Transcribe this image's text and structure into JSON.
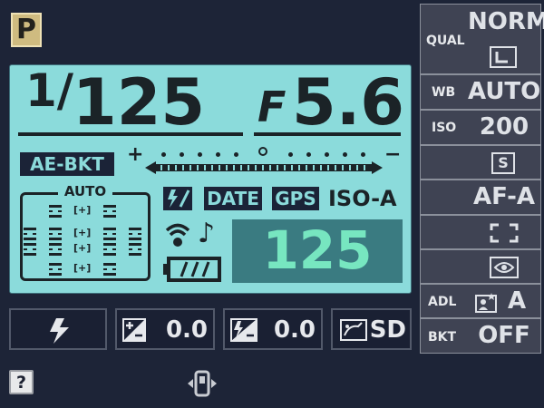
{
  "mode": "P",
  "exposure": {
    "shutter_prefix": "1/",
    "shutter_value": "125",
    "aperture_prefix": "F",
    "aperture_value": "5.6",
    "bracketing_label": "AE-BKT",
    "meter_plus": "+",
    "meter_minus": "−",
    "meter_value": 0
  },
  "focus": {
    "area_label": "AUTO"
  },
  "indicators": {
    "date": "DATE",
    "gps": "GPS",
    "iso_auto": "ISO-A",
    "iso_value": "125"
  },
  "bottom_info": {
    "flash_comp": "0.0",
    "exposure_comp": "0.0",
    "picture_control": "SD"
  },
  "settings": {
    "qual_label": "QUAL",
    "qual_value": "NORM",
    "wb_label": "WB",
    "wb_value": "AUTO",
    "iso_label": "ISO",
    "iso_value": "200",
    "release_value": "S",
    "af_value": "AF-A",
    "adl_label": "ADL",
    "adl_value": "A",
    "bkt_label": "BKT",
    "bkt_value": "OFF"
  },
  "help": {
    "label": "?"
  },
  "colors": {
    "lcd": "#8bdbdb",
    "lcd_ink": "#1b2327",
    "iso_display_bg": "#3a7b81",
    "iso_display_text": "#77e6c0",
    "background": "#1d2437",
    "panel": "#3f4353"
  },
  "icons": [
    "flash-icon",
    "exposure-comp-icon",
    "flash-comp-icon",
    "picture-control-icon",
    "wifi-icon",
    "music-icon",
    "battery-icon",
    "image-size-icon",
    "release-mode-icon",
    "af-area-icon",
    "metering-icon",
    "adl-icon",
    "multi-selector-icon"
  ]
}
